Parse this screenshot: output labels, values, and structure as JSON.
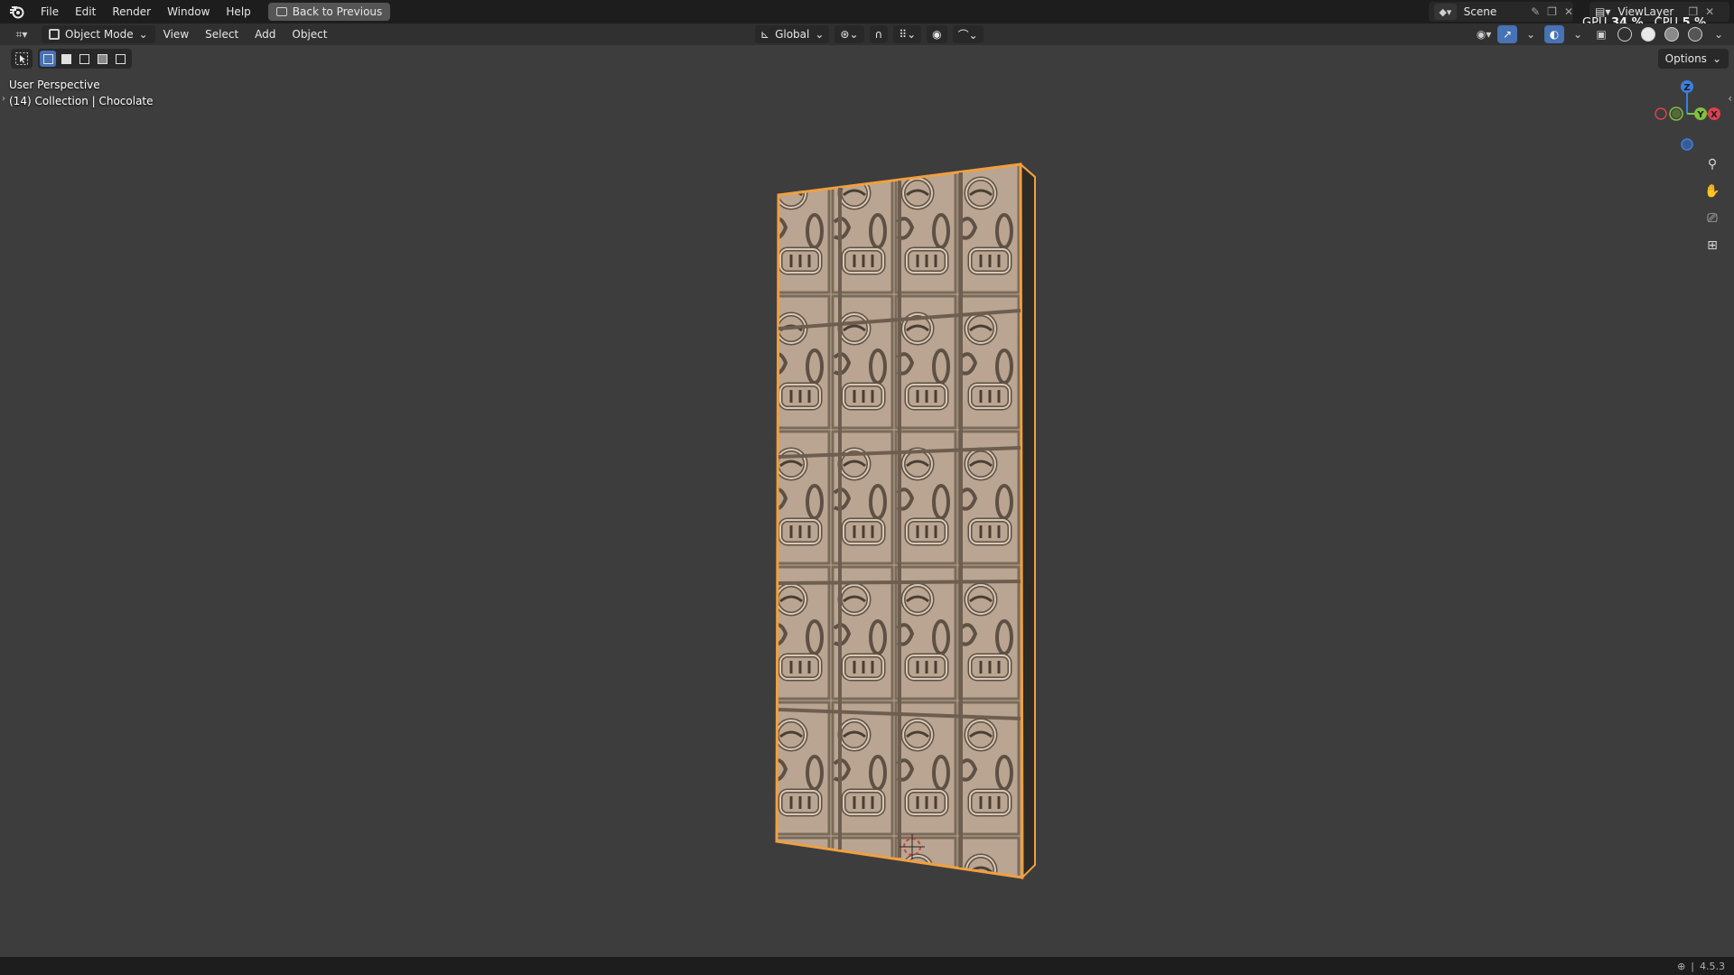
{
  "topbar": {
    "menus": [
      "File",
      "Edit",
      "Render",
      "Window",
      "Help"
    ],
    "back_label": "Back to Previous",
    "scene_name": "Scene",
    "view_layer": "ViewLayer",
    "gpu_label": "GPU",
    "gpu_value": "34 %",
    "cpu_label": "CPU",
    "cpu_value": "5 %"
  },
  "header": {
    "mode_label": "Object Mode",
    "menus": [
      "View",
      "Select",
      "Add",
      "Object"
    ],
    "orientation_label": "Global"
  },
  "subheader": {
    "options_label": "Options"
  },
  "viewport": {
    "perspective_label": "User Perspective",
    "collection_label": "(14) Collection | Chocolate",
    "gizmo_axes": [
      "Z",
      "Y",
      "X"
    ]
  },
  "statusbar": {
    "version": "4.5.3"
  },
  "colors": {
    "selection_outline": "#f0a040",
    "chocolate_surface": "#b9a591",
    "viewport_bg": "#3d3d3d",
    "axis_x": "#e04050",
    "axis_y": "#80c040",
    "axis_z": "#3a80e0"
  },
  "icons": [
    "blender-logo-icon",
    "editor-type-icon",
    "cursor-tool-icon",
    "pin-icon",
    "zoom-icon",
    "hand-pan-icon",
    "camera-icon",
    "grid-icon",
    "world-icon"
  ]
}
